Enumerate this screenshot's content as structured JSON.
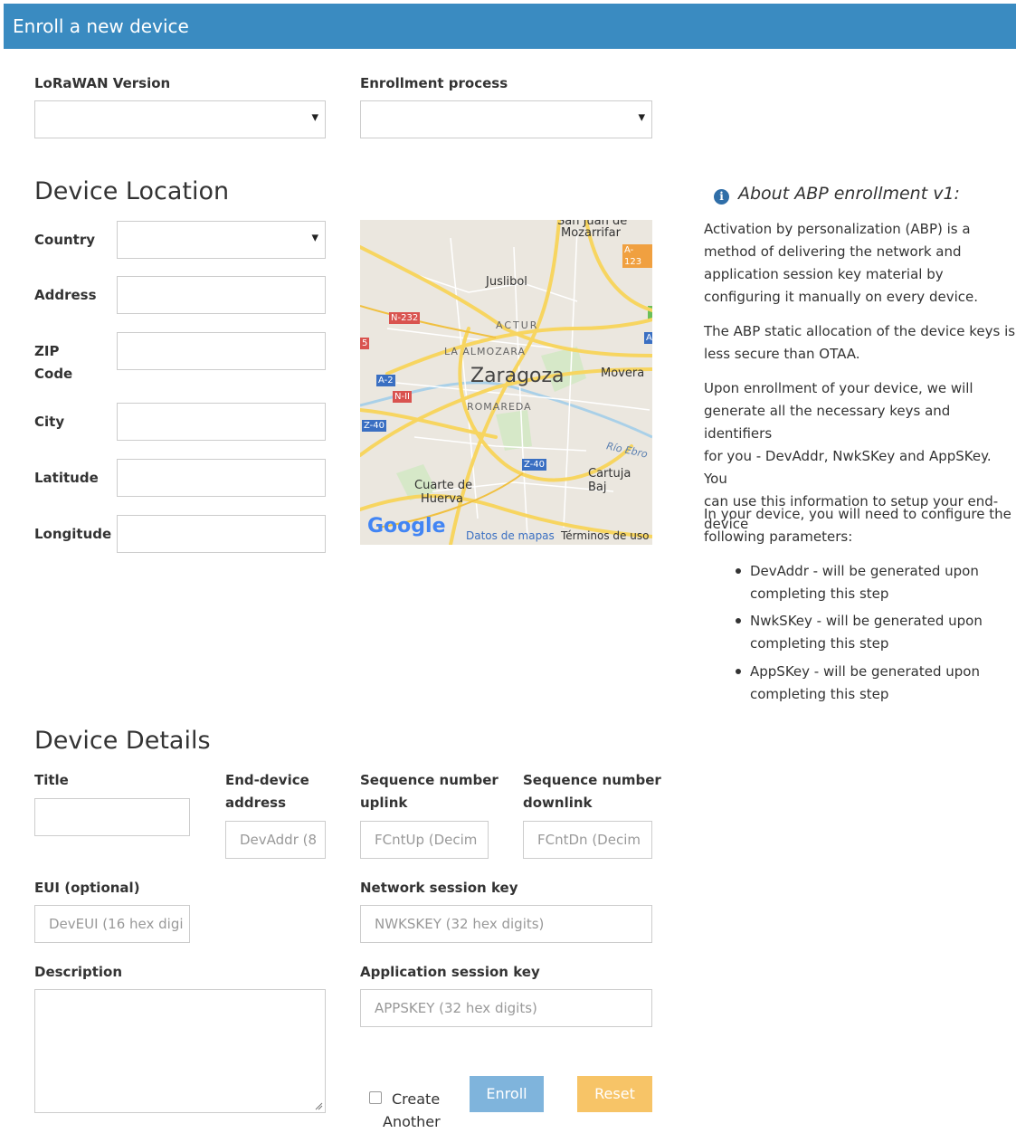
{
  "header": {
    "title": "Enroll a new device"
  },
  "top_form": {
    "lorawan_version_label": "LoRaWAN Version",
    "enrollment_process_label": "Enrollment process"
  },
  "location": {
    "heading": "Device Location",
    "country_label": "Country",
    "address_label": "Address",
    "zip_label_1": "ZIP",
    "zip_label_2": "Code",
    "city_label": "City",
    "latitude_label": "Latitude",
    "longitude_label": "Longitude"
  },
  "map": {
    "labels": {
      "san_juan_top": "San Juan de",
      "mozarrifar": "Mozarrifar",
      "juslibol": "Juslibol",
      "actur": "ACTUR",
      "la_almozara": "LA ALMOZARA",
      "zaragoza": "Zaragoza",
      "movera": "Movera",
      "romareda": "ROMAREDA",
      "rio_ebro": "Río Ebro",
      "cartuja": "Cartuja Baj",
      "cuarte_1": "Cuarte de",
      "cuarte_2": "Huerva"
    },
    "road_badges": {
      "a123": "A-123",
      "n232": "N-232",
      "a2": "A-2",
      "n2": "N-II",
      "z40_left": "Z-40",
      "z40_bottom": "Z-40",
      "edge_a": "A",
      "edge_5": "5"
    },
    "footer": {
      "google": "Google",
      "data_link": "Datos de mapas",
      "terms_link": "Términos de uso"
    }
  },
  "info": {
    "title": "About ABP enrollment v1:",
    "icon": "info-circle-icon",
    "paragraphs": [
      [
        "Activation by personalization (ABP) is a",
        "method of delivering the network and",
        "application session key material by",
        "configuring it manually on every device."
      ],
      [
        "The ABP static allocation of the device keys is",
        "less secure than OTAA."
      ],
      [
        "Upon enrollment of your device, we will",
        "generate all the necessary keys and identifiers",
        "for you - DevAddr, NwkSKey and AppSKey. You",
        "can use this information to setup your end-",
        "device"
      ],
      [
        "In your device, you will need to configure the",
        "following parameters:"
      ]
    ],
    "bullets": [
      [
        "DevAddr - will be generated upon",
        "completing this step"
      ],
      [
        "NwkSKey - will be generated upon",
        "completing this step"
      ],
      [
        "AppSKey - will be generated upon",
        "completing this step"
      ]
    ]
  },
  "details": {
    "heading": "Device Details",
    "title_label": "Title",
    "end_device_label_1": "End-device",
    "end_device_label_2": "address",
    "seq_up_label_1": "Sequence number",
    "seq_up_label_2": "uplink",
    "seq_down_label_1": "Sequence number",
    "seq_down_label_2": "downlink",
    "devaddr_placeholder": "DevAddr (8",
    "fcntup_placeholder": "FCntUp (Decim",
    "fcntdn_placeholder": "FCntDn (Decim",
    "eui_label": "EUI (optional)",
    "deveui_placeholder": "DevEUI (16 hex digi",
    "nwk_label": "Network session key",
    "nwk_placeholder": "NWKSKEY (32 hex digits)",
    "description_label": "Description",
    "app_label": "Application session key",
    "app_placeholder": "APPSKEY (32 hex digits)"
  },
  "actions": {
    "create_another_1": "Create",
    "create_another_2": "Another",
    "enroll": "Enroll",
    "reset": "Reset",
    "enroll_color": "#7fb4dc",
    "reset_color": "#f7c467"
  }
}
